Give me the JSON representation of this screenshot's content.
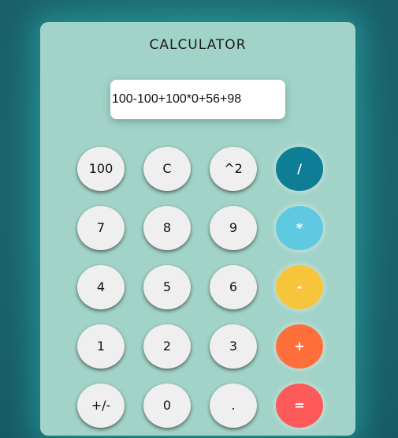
{
  "title": "CALCULATOR",
  "display": {
    "value": "100-100+100*0+56+98"
  },
  "keys": {
    "k100": "100",
    "clear": "C",
    "square": "^2",
    "divide": "/",
    "seven": "7",
    "eight": "8",
    "nine": "9",
    "multiply": "*",
    "four": "4",
    "five": "5",
    "six": "6",
    "subtract": "-",
    "one": "1",
    "two": "2",
    "three": "3",
    "add": "+",
    "negate": "+/-",
    "zero": "0",
    "decimal": ".",
    "equals": "="
  },
  "colors": {
    "divide": "#0e7d96",
    "multiply": "#5ec9e0",
    "subtract": "#f7c53c",
    "add": "#ff6f3c",
    "equals": "#ff5a5a",
    "panel": "#a2d3c8",
    "key": "#efefef"
  }
}
